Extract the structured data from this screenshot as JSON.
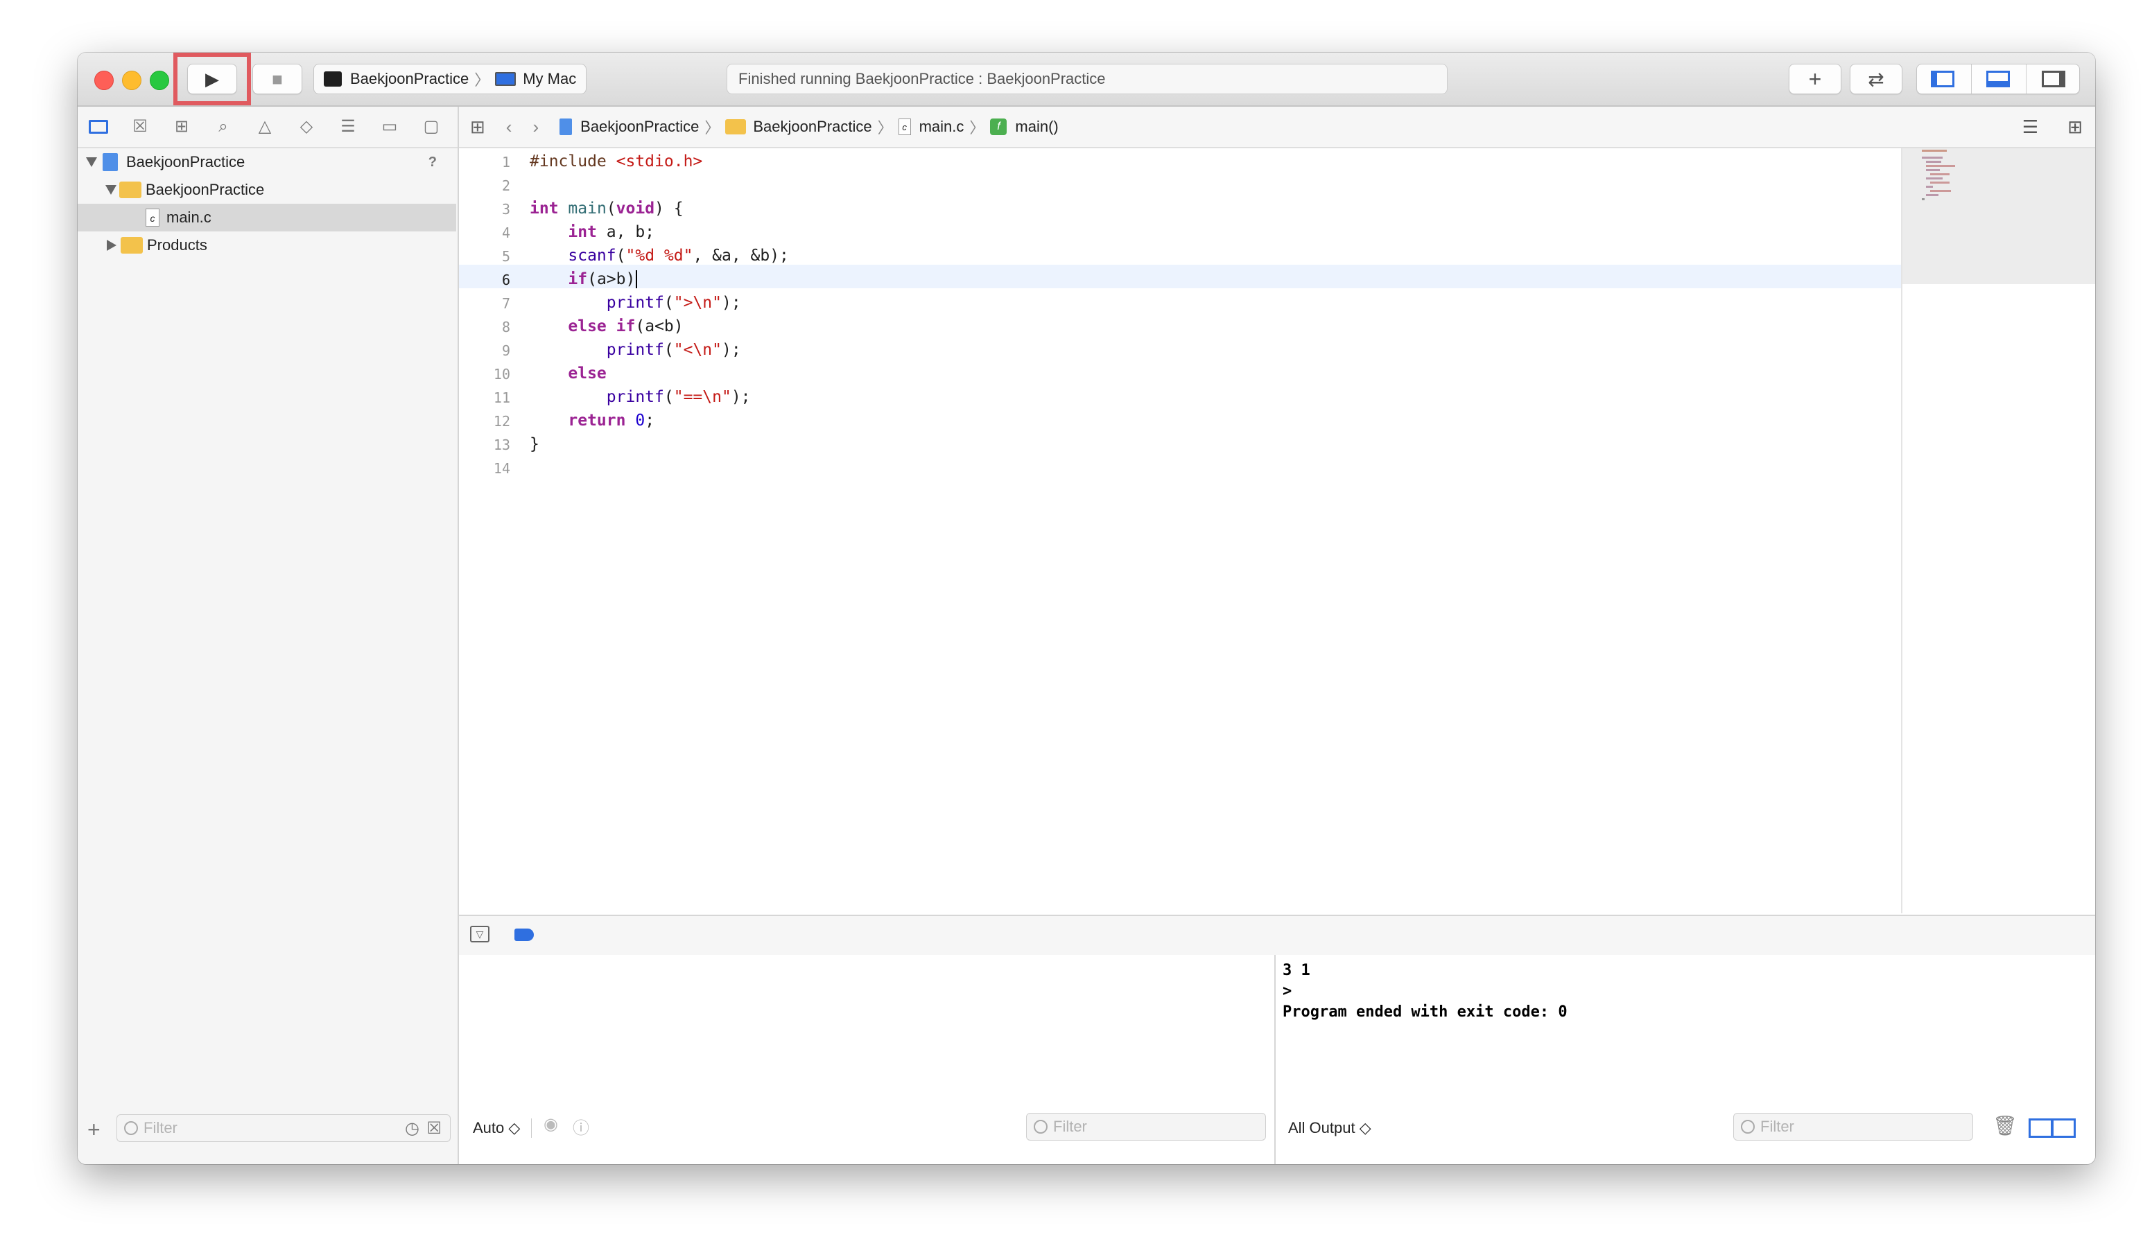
{
  "toolbar": {
    "run_label": "▶",
    "stop_label": "■",
    "scheme_name": "BaekjoonPractice",
    "destination": "My Mac",
    "activity_status": "Finished running BaekjoonPractice : BaekjoonPractice",
    "add_label": "+",
    "swap_label": "⇄"
  },
  "navigator": {
    "tree": [
      {
        "label": "BaekjoonPractice",
        "badge": "?"
      },
      {
        "label": "BaekjoonPractice"
      },
      {
        "label": "main.c"
      },
      {
        "label": "Products"
      }
    ],
    "filter_placeholder": "Filter",
    "add_label": "+"
  },
  "jumpbar": {
    "crumbs": [
      "BaekjoonPractice",
      "BaekjoonPractice",
      "main.c",
      "main()"
    ]
  },
  "editor": {
    "line_numbers": [
      "1",
      "2",
      "3",
      "4",
      "5",
      "6",
      "7",
      "8",
      "9",
      "10",
      "11",
      "12",
      "13",
      "14"
    ],
    "current_line": "6"
  },
  "debug": {
    "variables_scope": "Auto ◇",
    "variables_filter_placeholder": "Filter",
    "console_scope": "All Output ◇",
    "console_filter_placeholder": "Filter",
    "console_output": "3 1\n>\nProgram ended with exit code: 0"
  },
  "colors": {
    "accent": "#2f6fe0",
    "run_highlight": "#e05a5f",
    "current_line_bg": "#ecf3fe"
  }
}
